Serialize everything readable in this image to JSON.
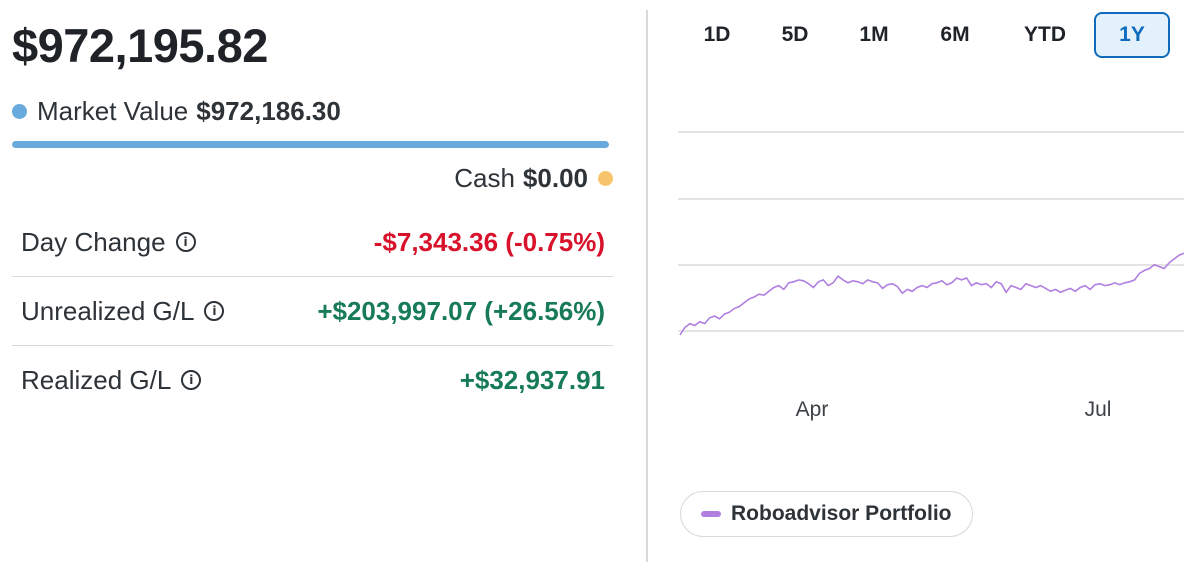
{
  "summary": {
    "total_value": "$972,195.82",
    "market_value_label": "Market Value",
    "market_value": "$972,186.30",
    "cash_label": "Cash",
    "cash_value": "$0.00",
    "allocation_market_fraction": 1.0
  },
  "stats": [
    {
      "label": "Day Change",
      "value": "-$7,343.36 (-0.75%)",
      "tone": "neg"
    },
    {
      "label": "Unrealized G/L",
      "value": "+$203,997.07 (+26.56%)",
      "tone": "pos"
    },
    {
      "label": "Realized G/L",
      "value": "+$32,937.91",
      "tone": "pos"
    }
  ],
  "ranges": {
    "items": [
      "1D",
      "5D",
      "1M",
      "6M",
      "YTD",
      "1Y"
    ],
    "selected": "1Y"
  },
  "colors": {
    "market": "#69aadc",
    "cash": "#f7c46c",
    "negative": "#d7122a",
    "positive": "#177a5b",
    "series": "#b07fe0",
    "active_range": "#0f6cbd"
  },
  "chart_data": {
    "type": "line",
    "x_tick_labels": [
      "Apr",
      "Jul"
    ],
    "series": [
      {
        "name": "Roboadvisor Portfolio",
        "values": [
          0.0,
          0.08,
          0.12,
          0.1,
          0.14,
          0.12,
          0.18,
          0.2,
          0.17,
          0.22,
          0.24,
          0.28,
          0.3,
          0.34,
          0.38,
          0.4,
          0.43,
          0.42,
          0.46,
          0.5,
          0.52,
          0.48,
          0.55,
          0.56,
          0.58,
          0.57,
          0.54,
          0.5,
          0.56,
          0.58,
          0.52,
          0.55,
          0.62,
          0.58,
          0.55,
          0.57,
          0.56,
          0.54,
          0.58,
          0.56,
          0.55,
          0.49,
          0.53,
          0.54,
          0.51,
          0.44,
          0.48,
          0.46,
          0.5,
          0.52,
          0.5,
          0.54,
          0.55,
          0.57,
          0.53,
          0.55,
          0.6,
          0.58,
          0.6,
          0.52,
          0.55,
          0.53,
          0.54,
          0.5,
          0.56,
          0.54,
          0.45,
          0.52,
          0.5,
          0.48,
          0.54,
          0.52,
          0.5,
          0.52,
          0.49,
          0.46,
          0.48,
          0.45,
          0.47,
          0.49,
          0.46,
          0.5,
          0.52,
          0.48,
          0.53,
          0.54,
          0.52,
          0.53,
          0.55,
          0.53,
          0.55,
          0.56,
          0.58,
          0.65,
          0.68,
          0.7,
          0.74,
          0.72,
          0.7,
          0.76,
          0.8,
          0.84,
          0.86
        ]
      }
    ],
    "legend_label": "Roboadvisor Portfolio",
    "legend_position": "bottom-left",
    "grid": true
  }
}
